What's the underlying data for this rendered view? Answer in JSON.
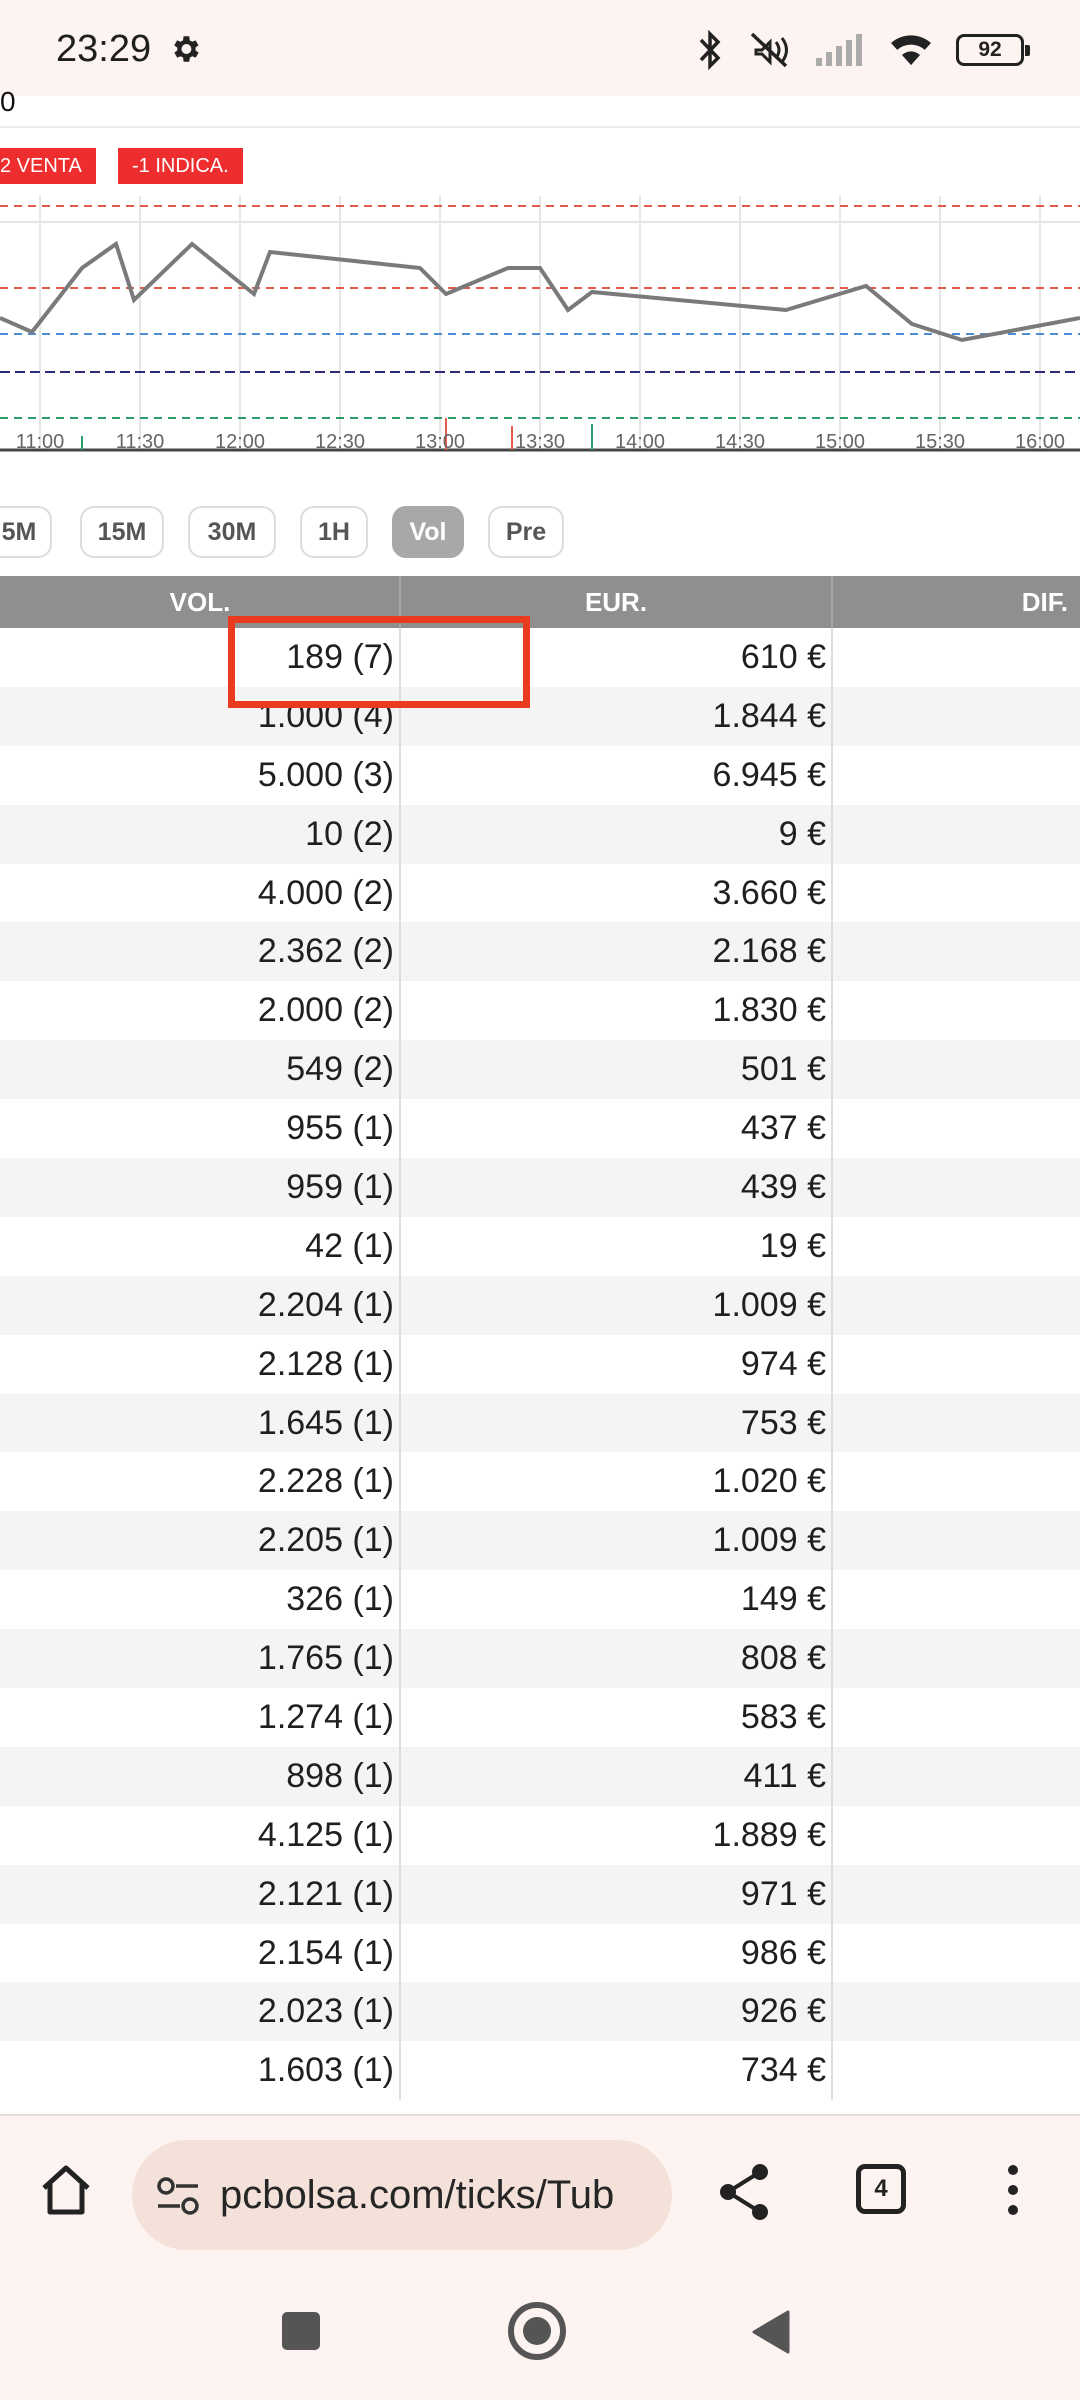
{
  "status_bar": {
    "time": "23:29",
    "icons": [
      "gear-icon",
      "bluetooth-icon",
      "mute-vibrate-icon",
      "cellular-signal-icon",
      "wifi-icon"
    ],
    "battery": "92"
  },
  "chart": {
    "top_label": "0",
    "badges": {
      "sell": "2 VENTA",
      "indicator": "-1 INDICA."
    },
    "x_ticks": [
      "11:00",
      "11:30",
      "12:00",
      "12:30",
      "13:00",
      "13:30",
      "14:00",
      "14:30",
      "15:00",
      "15:30",
      "16:00"
    ],
    "colors": {
      "line": "#777777",
      "red_levels": "#e05a4e",
      "blue_level": "#4a8fd6",
      "navy_level": "#2b2b7a",
      "green_level": "#2e9b6a"
    }
  },
  "timeframes": [
    {
      "label": "5M",
      "active": false
    },
    {
      "label": "15M",
      "active": false
    },
    {
      "label": "30M",
      "active": false
    },
    {
      "label": "1H",
      "active": false
    },
    {
      "label": "Vol",
      "active": true
    },
    {
      "label": "Pre",
      "active": false
    }
  ],
  "table": {
    "headers": {
      "vol": "VOL.",
      "eur": "EUR.",
      "dif": "DIF."
    },
    "rows": [
      {
        "vol": "189 (7)",
        "eur": "610 €"
      },
      {
        "vol": "1.000 (4)",
        "eur": "1.844 €"
      },
      {
        "vol": "5.000 (3)",
        "eur": "6.945 €"
      },
      {
        "vol": "10 (2)",
        "eur": "9 €"
      },
      {
        "vol": "4.000 (2)",
        "eur": "3.660 €"
      },
      {
        "vol": "2.362 (2)",
        "eur": "2.168 €"
      },
      {
        "vol": "2.000 (2)",
        "eur": "1.830 €"
      },
      {
        "vol": "549 (2)",
        "eur": "501 €"
      },
      {
        "vol": "955 (1)",
        "eur": "437 €"
      },
      {
        "vol": "959 (1)",
        "eur": "439 €"
      },
      {
        "vol": "42 (1)",
        "eur": "19 €"
      },
      {
        "vol": "2.204 (1)",
        "eur": "1.009 €"
      },
      {
        "vol": "2.128 (1)",
        "eur": "974 €"
      },
      {
        "vol": "1.645 (1)",
        "eur": "753 €"
      },
      {
        "vol": "2.228 (1)",
        "eur": "1.020 €"
      },
      {
        "vol": "2.205 (1)",
        "eur": "1.009 €"
      },
      {
        "vol": "326 (1)",
        "eur": "149 €"
      },
      {
        "vol": "1.765 (1)",
        "eur": "808 €"
      },
      {
        "vol": "1.274 (1)",
        "eur": "583 €"
      },
      {
        "vol": "898 (1)",
        "eur": "411 €"
      },
      {
        "vol": "4.125 (1)",
        "eur": "1.889 €"
      },
      {
        "vol": "2.121 (1)",
        "eur": "971 €"
      },
      {
        "vol": "2.154 (1)",
        "eur": "986 €"
      },
      {
        "vol": "2.023 (1)",
        "eur": "926 €"
      },
      {
        "vol": "1.603 (1)",
        "eur": "734 €"
      }
    ],
    "highlight_color": "#ea3b1f"
  },
  "browser": {
    "url": "pcbolsa.com/ticks/Tub",
    "tab_count": "4"
  }
}
